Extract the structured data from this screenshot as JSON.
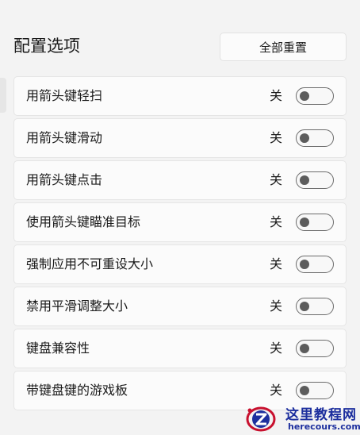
{
  "header": {
    "title": "配置选项",
    "reset_label": "全部重置"
  },
  "settings": [
    {
      "label": "用箭头键轻扫",
      "state": "关",
      "on": false
    },
    {
      "label": "用箭头键滑动",
      "state": "关",
      "on": false
    },
    {
      "label": "用箭头键点击",
      "state": "关",
      "on": false
    },
    {
      "label": "使用箭头键瞄准目标",
      "state": "关",
      "on": false
    },
    {
      "label": "强制应用不可重设大小",
      "state": "关",
      "on": false
    },
    {
      "label": "禁用平滑调整大小",
      "state": "关",
      "on": false
    },
    {
      "label": "键盘兼容性",
      "state": "关",
      "on": false
    },
    {
      "label": "带键盘键的游戏板",
      "state": "关",
      "on": false
    }
  ],
  "watermark": {
    "title": "这里教程网",
    "url": "herecours.com",
    "colors": {
      "primary": "#1d2f9e",
      "accent": "#c8102e"
    }
  }
}
